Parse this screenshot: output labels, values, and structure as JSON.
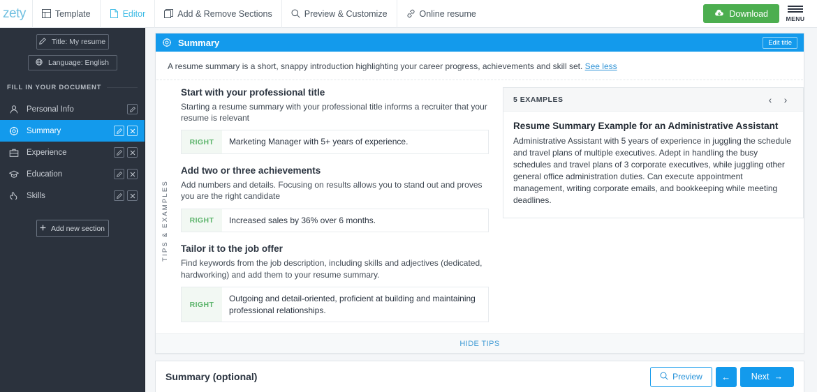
{
  "topbar": {
    "logo": "zety",
    "nav": [
      {
        "label": "Template",
        "icon": "template-icon",
        "active": false
      },
      {
        "label": "Editor",
        "icon": "document-icon",
        "active": true
      },
      {
        "label": "Add & Remove Sections",
        "icon": "sections-icon",
        "active": false
      },
      {
        "label": "Preview & Customize",
        "icon": "search-icon",
        "active": false
      },
      {
        "label": "Online resume",
        "icon": "link-icon",
        "active": false
      }
    ],
    "download_label": "Download",
    "download_icon": "cloud-download-icon",
    "menu_label": "MENU"
  },
  "sidebar": {
    "title_button": "Title: My resume",
    "language_button": "Language: English",
    "section_label": "FILL IN YOUR DOCUMENT",
    "items": [
      {
        "label": "Personal Info",
        "icon": "person-icon",
        "active": false,
        "has_edit": true,
        "has_delete": false
      },
      {
        "label": "Summary",
        "icon": "summary-icon",
        "active": true,
        "has_edit": true,
        "has_delete": true
      },
      {
        "label": "Experience",
        "icon": "briefcase-icon",
        "active": false,
        "has_edit": true,
        "has_delete": true
      },
      {
        "label": "Education",
        "icon": "graduation-cap-icon",
        "active": false,
        "has_edit": true,
        "has_delete": true
      },
      {
        "label": "Skills",
        "icon": "hand-skills-icon",
        "active": false,
        "has_edit": true,
        "has_delete": true
      }
    ],
    "add_section_label": "Add new section"
  },
  "tips_card": {
    "header_title": "Summary",
    "header_icon": "target-icon",
    "edit_title_label": "Edit title",
    "intro_text": "A resume summary is a short, snappy introduction highlighting your career progress, achievements and skill set.",
    "see_less_label": "See less",
    "vertical_tab_label": "TIPS & EXAMPLES",
    "tips": [
      {
        "heading": "Start with your professional title",
        "description": "Starting a resume summary with your professional title informs a recruiter that your resume is relevant",
        "badge": "RIGHT",
        "example": "Marketing Manager with 5+ years of experience."
      },
      {
        "heading": "Add two or three achievements",
        "description": "Add numbers and details. Focusing on results allows you to stand out and proves you are the right candidate",
        "badge": "RIGHT",
        "example": "Increased sales by 36% over 6 months."
      },
      {
        "heading": "Tailor it to the job offer",
        "description": "Find keywords from the job description, including skills and adjectives (dedicated, hardworking) and add them to your resume summary.",
        "badge": "RIGHT",
        "example": "Outgoing and detail-oriented, proficient at building and maintaining professional relationships."
      }
    ],
    "examples_panel": {
      "count_label": "5 EXAMPLES",
      "prev_icon": "chevron-left-icon",
      "next_icon": "chevron-right-icon",
      "example_title": "Resume Summary Example for an Administrative Assistant",
      "example_body": "Administrative Assistant with 5 years of experience in juggling the schedule and travel plans of multiple executives. Adept in handling the busy schedules and travel plans of 3 corporate executives, while juggling other general office administration duties. Can execute appointment management, writing corporate emails, and bookkeeping while meeting deadlines."
    },
    "hide_tips_label": "HIDE TIPS"
  },
  "bottom_bar": {
    "title": "Summary (optional)",
    "preview_label": "Preview",
    "preview_icon": "search-icon",
    "back_label": "←",
    "next_label": "Next",
    "next_arrow": "→"
  },
  "colors": {
    "accent_blue": "#139aec",
    "download_green": "#4cae4f",
    "sidebar_dark": "#2b323d",
    "badge_green": "#5cb46b",
    "link_blue": "#2f93d6"
  }
}
